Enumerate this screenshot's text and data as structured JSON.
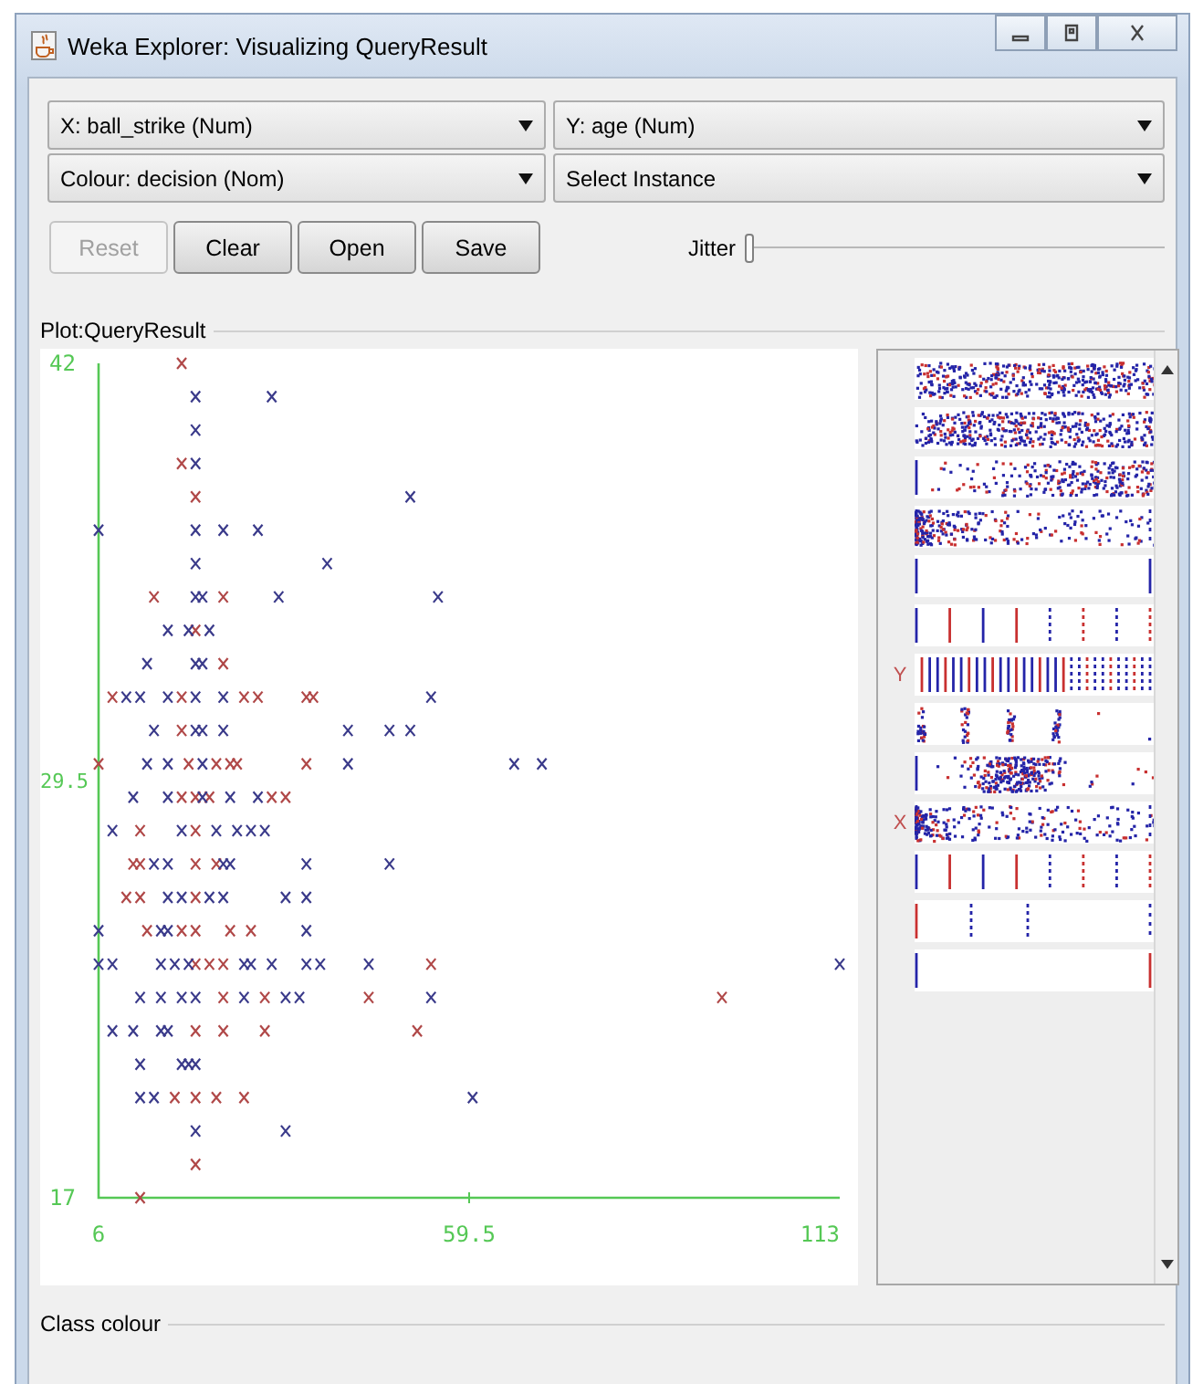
{
  "window": {
    "title": "Weka Explorer: Visualizing QueryResult"
  },
  "selectors": [
    {
      "label": "X: ball_strike (Num)"
    },
    {
      "label": "Y: age (Num)"
    },
    {
      "label": "Colour: decision (Nom)"
    },
    {
      "label": "Select Instance"
    }
  ],
  "buttons": [
    {
      "label": "Reset",
      "disabled": true
    },
    {
      "label": "Clear",
      "disabled": false
    },
    {
      "label": "Open",
      "disabled": false
    },
    {
      "label": "Save",
      "disabled": false
    }
  ],
  "jitter": {
    "label": "Jitter",
    "level": 0
  },
  "plot": {
    "title": "Plot:QueryResult",
    "chart_data": {
      "type": "scatter",
      "xlim": [
        6,
        113
      ],
      "ylim": [
        17,
        42
      ],
      "xticks": [
        {
          "value": 6,
          "label": "6"
        },
        {
          "value": 59.5,
          "label": "59.5"
        },
        {
          "value": 113,
          "label": "113"
        }
      ],
      "yticks": [
        {
          "value": 17,
          "label": "17"
        },
        {
          "value": 29.5,
          "label": "29.5"
        },
        {
          "value": 42,
          "label": "42"
        }
      ],
      "series": [
        {
          "color": "#b04848",
          "x": [
            18,
            18,
            20,
            14,
            24,
            20,
            24,
            8,
            18,
            27,
            29,
            36,
            37,
            18,
            6,
            19,
            23,
            25,
            26,
            36,
            18,
            20,
            22,
            31,
            33,
            12,
            20,
            11,
            12,
            20,
            23,
            10,
            12,
            20,
            13,
            18,
            20,
            25,
            28,
            20,
            22,
            24,
            54,
            24,
            30,
            45,
            96,
            20,
            24,
            30,
            52,
            17,
            20,
            23,
            27,
            20,
            12
          ],
          "values": [
            42,
            39,
            38,
            35,
            35,
            34,
            33,
            32,
            32,
            32,
            32,
            32,
            32,
            31,
            30,
            30,
            30,
            30,
            30,
            30,
            29,
            29,
            29,
            29,
            29,
            28,
            28,
            27,
            27,
            27,
            27,
            26,
            26,
            26,
            25,
            25,
            25,
            25,
            25,
            24,
            24,
            24,
            24,
            23,
            23,
            23,
            23,
            22,
            22,
            22,
            22,
            20,
            20,
            20,
            20,
            18,
            17
          ]
        },
        {
          "color": "#3a3a8a",
          "x": [
            20,
            31,
            20,
            20,
            51,
            6,
            20,
            24,
            29,
            20,
            39,
            20,
            21,
            32,
            55,
            16,
            19,
            22,
            13,
            20,
            21,
            10,
            12,
            16,
            20,
            24,
            54,
            14,
            20,
            21,
            24,
            42,
            48,
            51,
            13,
            16,
            21,
            42,
            66,
            70,
            11,
            16,
            21,
            25,
            29,
            8,
            18,
            23,
            26,
            28,
            30,
            14,
            16,
            24,
            25,
            36,
            48,
            16,
            18,
            22,
            24,
            33,
            36,
            6,
            15,
            16,
            36,
            6,
            8,
            15,
            17,
            19,
            27,
            28,
            31,
            36,
            38,
            45,
            113,
            12,
            15,
            18,
            20,
            27,
            33,
            35,
            54,
            8,
            11,
            15,
            16,
            12,
            18,
            19,
            20,
            12,
            14,
            60,
            20,
            33
          ],
          "values": [
            41,
            41,
            40,
            39,
            38,
            37,
            37,
            37,
            37,
            36,
            36,
            35,
            35,
            35,
            35,
            34,
            34,
            34,
            33,
            33,
            33,
            32,
            32,
            32,
            32,
            32,
            32,
            31,
            31,
            31,
            31,
            31,
            31,
            31,
            30,
            30,
            30,
            30,
            30,
            30,
            29,
            29,
            29,
            29,
            29,
            28,
            28,
            28,
            28,
            28,
            28,
            27,
            27,
            27,
            27,
            27,
            27,
            26,
            26,
            26,
            26,
            26,
            26,
            25,
            25,
            25,
            25,
            24,
            24,
            24,
            24,
            24,
            24,
            24,
            24,
            24,
            24,
            24,
            24,
            23,
            23,
            23,
            23,
            23,
            23,
            23,
            23,
            22,
            22,
            22,
            22,
            21,
            21,
            21,
            21,
            20,
            20,
            20,
            19,
            19
          ]
        }
      ]
    }
  },
  "attribute_strips": [
    {
      "kind": "noise"
    },
    {
      "kind": "noise"
    },
    {
      "kind": "ramp"
    },
    {
      "kind": "left-cluster"
    },
    {
      "kind": "edges"
    },
    {
      "kind": "columns"
    },
    {
      "kind": "dense-columns",
      "marker": "Y"
    },
    {
      "kind": "groups"
    },
    {
      "kind": "mid-cluster"
    },
    {
      "kind": "left-cluster",
      "marker": "X"
    },
    {
      "kind": "columns"
    },
    {
      "kind": "sparse-columns"
    },
    {
      "kind": "edges"
    }
  ],
  "class_colour": {
    "title": "Class colour"
  }
}
